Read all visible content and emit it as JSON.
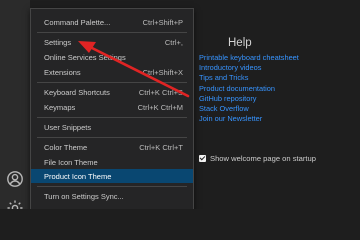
{
  "menu": {
    "items": [
      {
        "label": "Command Palette...",
        "keys": "Ctrl+Shift+P"
      },
      {
        "label": "Settings",
        "keys": "Ctrl+,"
      },
      {
        "label": "Online Services Settings",
        "keys": ""
      },
      {
        "label": "Extensions",
        "keys": "Ctrl+Shift+X"
      },
      {
        "label": "Keyboard Shortcuts",
        "keys": "Ctrl+K Ctrl+S"
      },
      {
        "label": "Keymaps",
        "keys": "Ctrl+K Ctrl+M"
      },
      {
        "label": "User Snippets",
        "keys": ""
      },
      {
        "label": "Color Theme",
        "keys": "Ctrl+K Ctrl+T"
      },
      {
        "label": "File Icon Theme",
        "keys": ""
      },
      {
        "label": "Product Icon Theme",
        "keys": ""
      },
      {
        "label": "Turn on Settings Sync...",
        "keys": ""
      }
    ],
    "active_index": 9
  },
  "welcome": {
    "help_title": "Help",
    "links": [
      "Printable keyboard cheatsheet",
      "Introductory videos",
      "Tips and Tricks",
      "Product documentation",
      "GitHub repository",
      "Stack Overflow",
      "Join our Newsletter"
    ],
    "startup_label": "Show welcome page on startup",
    "startup_checked": true
  },
  "activity_bar": {
    "icons": [
      "account-icon",
      "gear-icon"
    ]
  },
  "colors": {
    "menu_bg": "#252526",
    "active_item": "#094771",
    "link": "#3794ff",
    "annotation_arrow": "#e02424"
  }
}
